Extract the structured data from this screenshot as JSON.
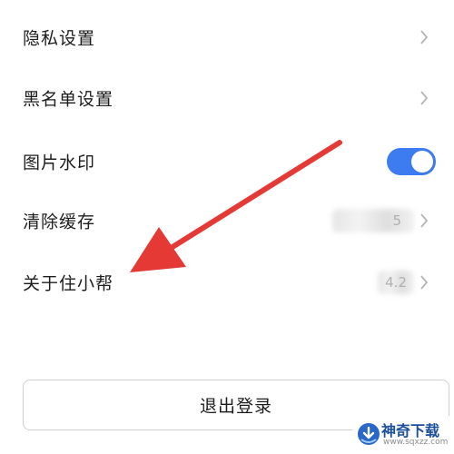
{
  "settings": {
    "items": [
      {
        "label": "隐私设置"
      },
      {
        "label": "黑名单设置"
      },
      {
        "label": "图片水印",
        "toggle_on": true
      },
      {
        "label": "清除缓存",
        "value": "5"
      },
      {
        "label": "关于住小帮",
        "value": "4.2"
      }
    ]
  },
  "logout": {
    "label": "退出登录"
  },
  "watermark": {
    "title": "神奇下载",
    "url": "www.sqxzz.com"
  },
  "colors": {
    "toggle_accent": "#3d7bf0",
    "annotation_arrow": "#e53935"
  }
}
